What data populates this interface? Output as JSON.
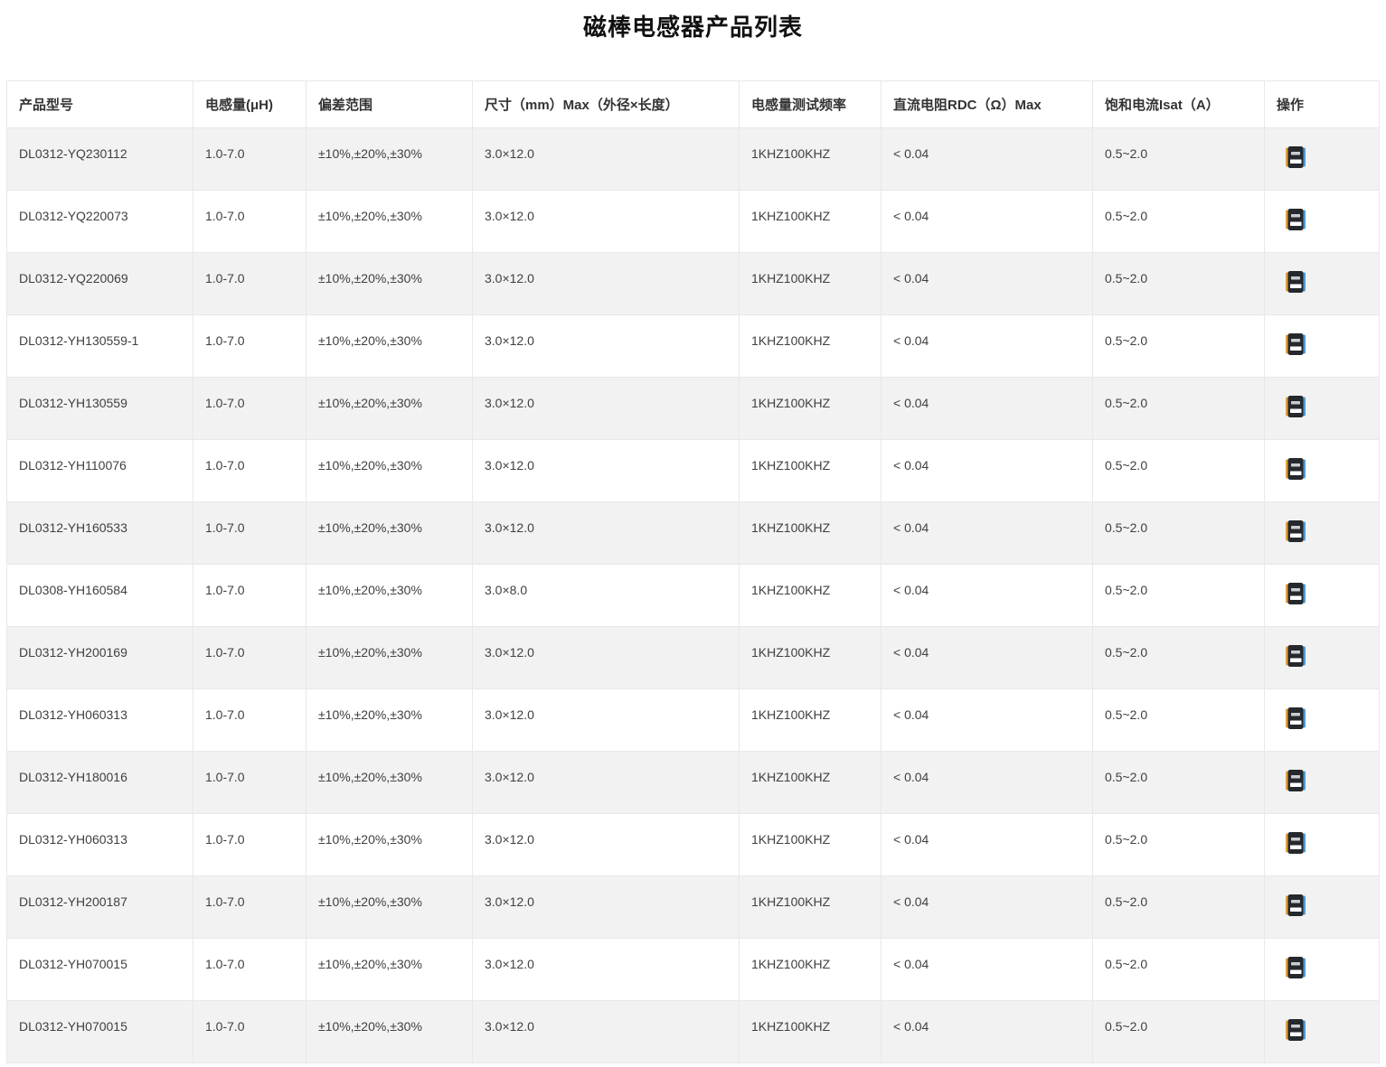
{
  "page": {
    "title": "磁棒电感器产品列表"
  },
  "table": {
    "columns": [
      "产品型号",
      "电感量(μH)",
      "偏差范围",
      "尺寸（mm）Max（外径×长度）",
      "电感量测试频率",
      "直流电阻RDC（Ω）Max",
      "饱和电流Isat（A）",
      "操作"
    ],
    "action_icon": "book-icon",
    "rows": [
      {
        "model": "DL0312-YQ230112",
        "inductance": "1.0-7.0",
        "tolerance": "±10%,±20%,±30%",
        "size": "3.0×12.0",
        "test_frequency": "1KHZ100KHZ",
        "rdc": "< 0.04",
        "isat": "0.5~2.0"
      },
      {
        "model": "DL0312-YQ220073",
        "inductance": "1.0-7.0",
        "tolerance": "±10%,±20%,±30%",
        "size": "3.0×12.0",
        "test_frequency": "1KHZ100KHZ",
        "rdc": "< 0.04",
        "isat": "0.5~2.0"
      },
      {
        "model": "DL0312-YQ220069",
        "inductance": "1.0-7.0",
        "tolerance": "±10%,±20%,±30%",
        "size": "3.0×12.0",
        "test_frequency": "1KHZ100KHZ",
        "rdc": "< 0.04",
        "isat": "0.5~2.0"
      },
      {
        "model": "DL0312-YH130559-1",
        "inductance": "1.0-7.0",
        "tolerance": "±10%,±20%,±30%",
        "size": "3.0×12.0",
        "test_frequency": "1KHZ100KHZ",
        "rdc": "< 0.04",
        "isat": "0.5~2.0"
      },
      {
        "model": "DL0312-YH130559",
        "inductance": "1.0-7.0",
        "tolerance": "±10%,±20%,±30%",
        "size": "3.0×12.0",
        "test_frequency": "1KHZ100KHZ",
        "rdc": "< 0.04",
        "isat": "0.5~2.0"
      },
      {
        "model": "DL0312-YH110076",
        "inductance": "1.0-7.0",
        "tolerance": "±10%,±20%,±30%",
        "size": "3.0×12.0",
        "test_frequency": "1KHZ100KHZ",
        "rdc": "< 0.04",
        "isat": "0.5~2.0"
      },
      {
        "model": "DL0312-YH160533",
        "inductance": "1.0-7.0",
        "tolerance": "±10%,±20%,±30%",
        "size": "3.0×12.0",
        "test_frequency": "1KHZ100KHZ",
        "rdc": "< 0.04",
        "isat": "0.5~2.0"
      },
      {
        "model": "DL0308-YH160584",
        "inductance": "1.0-7.0",
        "tolerance": "±10%,±20%,±30%",
        "size": "3.0×8.0",
        "test_frequency": "1KHZ100KHZ",
        "rdc": "< 0.04",
        "isat": "0.5~2.0"
      },
      {
        "model": "DL0312-YH200169",
        "inductance": "1.0-7.0",
        "tolerance": "±10%,±20%,±30%",
        "size": "3.0×12.0",
        "test_frequency": "1KHZ100KHZ",
        "rdc": "< 0.04",
        "isat": "0.5~2.0"
      },
      {
        "model": "DL0312-YH060313",
        "inductance": "1.0-7.0",
        "tolerance": "±10%,±20%,±30%",
        "size": "3.0×12.0",
        "test_frequency": "1KHZ100KHZ",
        "rdc": "< 0.04",
        "isat": "0.5~2.0"
      },
      {
        "model": "DL0312-YH180016",
        "inductance": "1.0-7.0",
        "tolerance": "±10%,±20%,±30%",
        "size": "3.0×12.0",
        "test_frequency": "1KHZ100KHZ",
        "rdc": "< 0.04",
        "isat": "0.5~2.0"
      },
      {
        "model": "DL0312-YH060313",
        "inductance": "1.0-7.0",
        "tolerance": "±10%,±20%,±30%",
        "size": "3.0×12.0",
        "test_frequency": "1KHZ100KHZ",
        "rdc": "< 0.04",
        "isat": "0.5~2.0"
      },
      {
        "model": "DL0312-YH200187",
        "inductance": "1.0-7.0",
        "tolerance": "±10%,±20%,±30%",
        "size": "3.0×12.0",
        "test_frequency": "1KHZ100KHZ",
        "rdc": "< 0.04",
        "isat": "0.5~2.0"
      },
      {
        "model": "DL0312-YH070015",
        "inductance": "1.0-7.0",
        "tolerance": "±10%,±20%,±30%",
        "size": "3.0×12.0",
        "test_frequency": "1KHZ100KHZ",
        "rdc": "< 0.04",
        "isat": "0.5~2.0"
      },
      {
        "model": "DL0312-YH070015",
        "inductance": "1.0-7.0",
        "tolerance": "±10%,±20%,±30%",
        "size": "3.0×12.0",
        "test_frequency": "1KHZ100KHZ",
        "rdc": "< 0.04",
        "isat": "0.5~2.0"
      }
    ]
  },
  "colors": {
    "alt_row_bg": "#f2f2f2",
    "border": "#e8e8e8",
    "cell_text": "#404040",
    "header_text": "#333333",
    "icon_body": "#25282d",
    "icon_spine_left": "#e0a13e",
    "icon_edge_right": "#4e9bd4"
  }
}
